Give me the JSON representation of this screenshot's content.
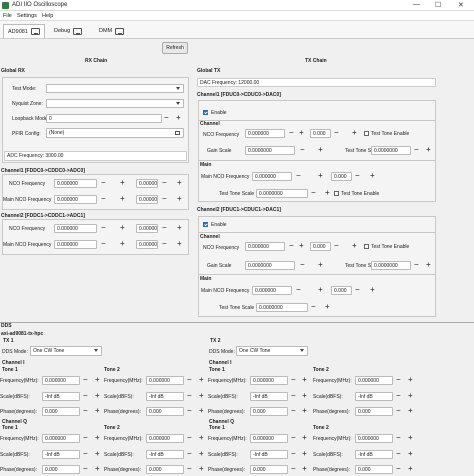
{
  "window": {
    "title": "ADI IIO Oscilloscope",
    "min": "—",
    "max": "☐",
    "close": "✕"
  },
  "menu": {
    "file": "File",
    "settings": "Settings",
    "help": "Help"
  },
  "tabs": [
    {
      "label": "AD9081"
    },
    {
      "label": "Debug"
    },
    {
      "label": "DMM"
    }
  ],
  "refresh": "Refresh",
  "rx": {
    "heading": "RX Chain",
    "global": "Global RX",
    "test_mode": "Test Mode:",
    "nyquist_zone": "Nyquist Zone:",
    "loopback_mode": "Loopback Mode:",
    "loopback_value": "0",
    "pfir_config": "PFIR Config:",
    "pfir_value": "(None)",
    "adc_freq": "ADC Frequency: 3000.00",
    "ch1": "Channel1 [FDDC0->CDDC0->ADC0]",
    "ch2": "Channel2 [FDDC1->CDDC1->ADC1]",
    "nco_freq": "NCO Frequency",
    "main_nco_freq": "Main NCO Frequency",
    "zero": "0.000000"
  },
  "tx": {
    "heading": "TX Chain",
    "global": "Global TX",
    "dac_freq": "DAC Frequency: 12000.00",
    "ch1": "Channel1 [FDUC0->CDUC0->DAC0]",
    "ch2": "Channel2 [FDUC1->CDUC1->DAC1]",
    "enable": "Enable",
    "channel": "Channel",
    "nco_freq": "NCO Frequency",
    "gain_scale": "Gain Scale",
    "test_tone_scale": "Test Tone Scale",
    "test_tone_enable": "Test Tone Enable",
    "main": "Main",
    "main_nco_freq": "Main NCO Frequency",
    "zero": "0.000000",
    "zero_short": "0.000",
    "gain_val": "0.0000000",
    "tts_val": "0.0000000"
  },
  "dds": {
    "heading": "DDS",
    "device": "axi-ad9081-tx-hpc",
    "tx1": "TX 1",
    "tx2": "TX 2",
    "mode_label": "DDS Mode:",
    "mode_value": "One CW Tone",
    "channel_i": "Channel I",
    "channel_q": "Channel Q",
    "tone1": "Tone 1",
    "tone2": "Tone 2",
    "freq": "Frequency(MHz):",
    "scale": "Scale(dBFS):",
    "phase": "Phase(degrees):",
    "freq_val": "0.000000",
    "scale_val": "-Inf dB",
    "phase_val": "0.000"
  }
}
